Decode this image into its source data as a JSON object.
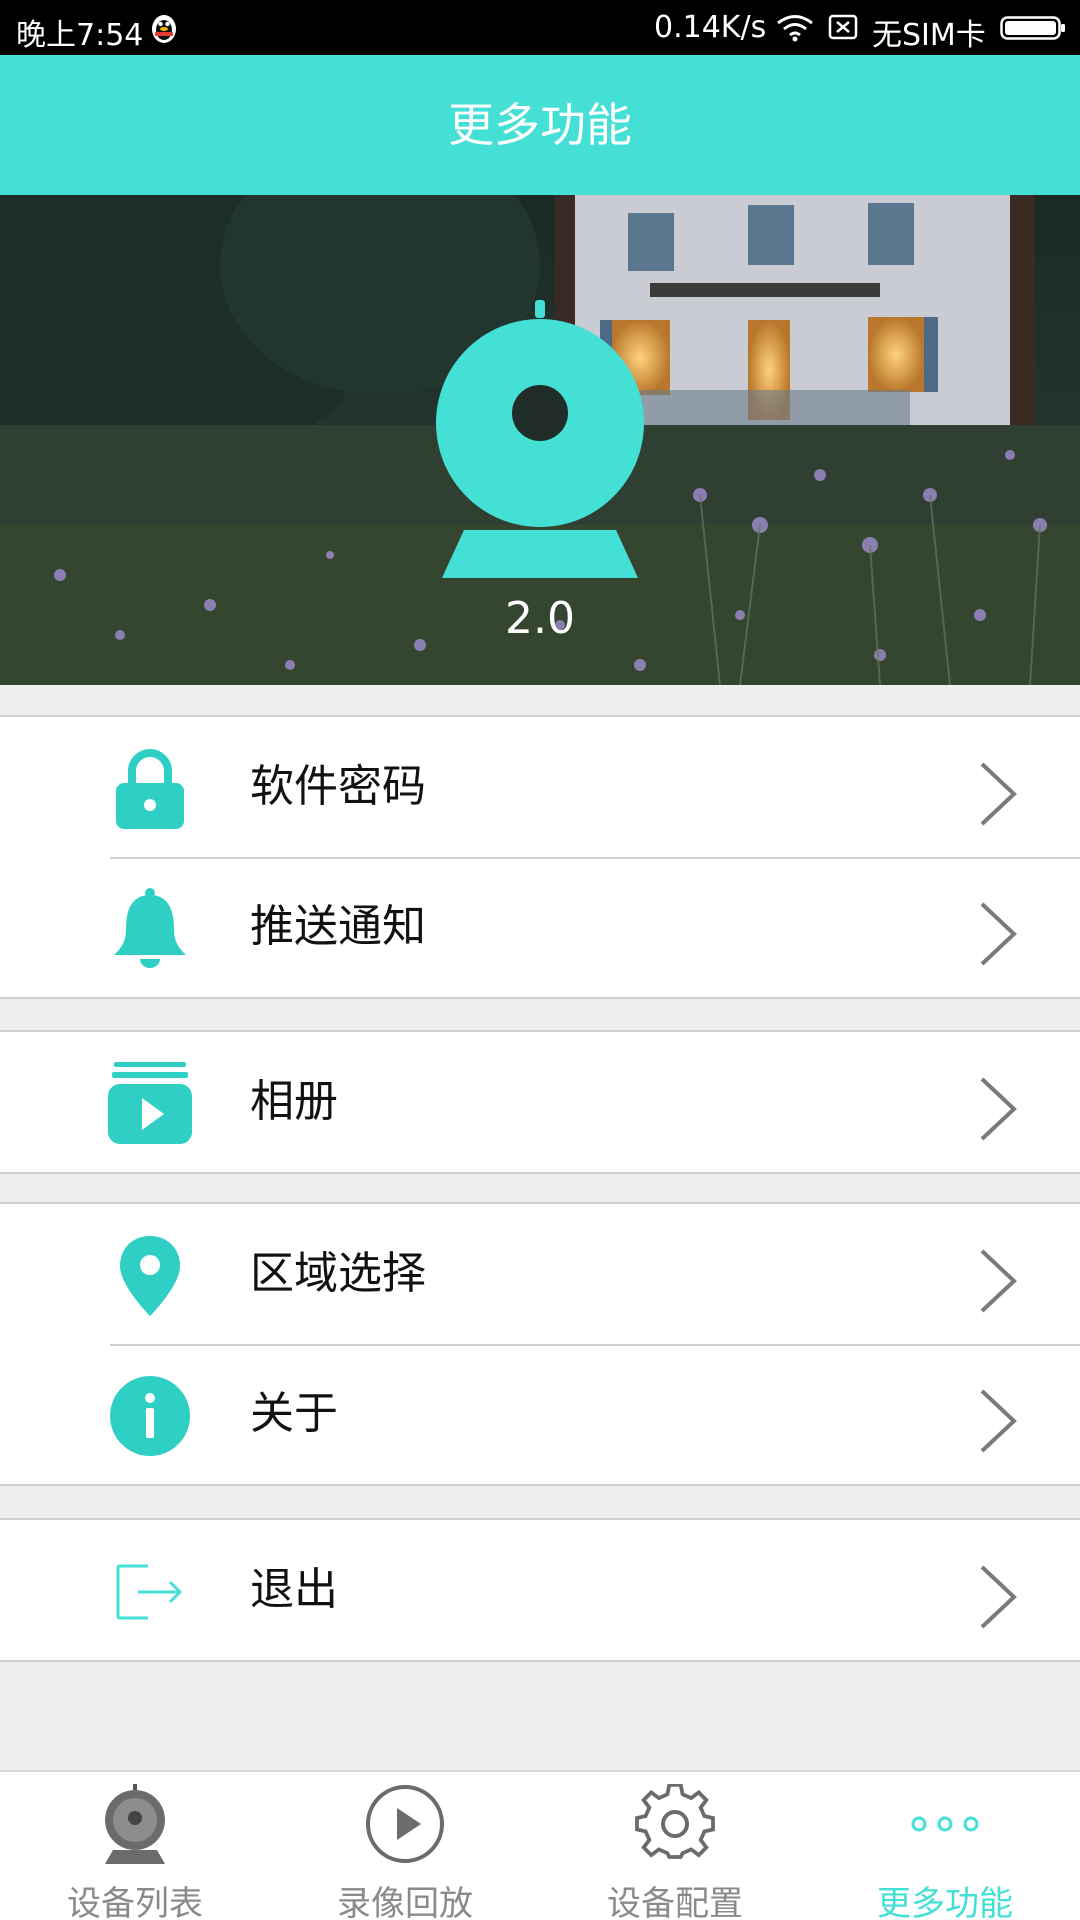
{
  "status_bar": {
    "time": "晚上7:54",
    "speed": "0.14K/s",
    "sim": "无SIM卡"
  },
  "header": {
    "title": "更多功能"
  },
  "banner": {
    "version": "2.0"
  },
  "menu": {
    "groups": [
      {
        "items": [
          {
            "label": "软件密码",
            "icon": "lock-icon"
          },
          {
            "label": "推送通知",
            "icon": "bell-icon"
          }
        ]
      },
      {
        "items": [
          {
            "label": "相册",
            "icon": "album-play-icon"
          }
        ]
      },
      {
        "items": [
          {
            "label": "区域选择",
            "icon": "location-pin-icon"
          },
          {
            "label": "关于",
            "icon": "info-icon"
          }
        ]
      },
      {
        "items": [
          {
            "label": "退出",
            "icon": "logout-icon"
          }
        ]
      }
    ]
  },
  "bottom_nav": {
    "tabs": [
      {
        "label": "设备列表",
        "icon": "camera-icon",
        "active": false
      },
      {
        "label": "录像回放",
        "icon": "play-circle-icon",
        "active": false
      },
      {
        "label": "设备配置",
        "icon": "gear-icon",
        "active": false
      },
      {
        "label": "更多功能",
        "icon": "more-dots-icon",
        "active": true
      }
    ]
  },
  "colors": {
    "accent": "#44dfd5",
    "icon": "#2fcfc5",
    "inactive_tab": "#8a8a8a",
    "chevron": "#7a7a7a"
  }
}
